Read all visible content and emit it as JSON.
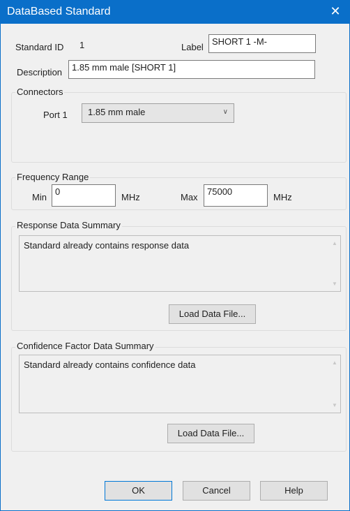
{
  "window": {
    "title": "DataBased Standard",
    "close_glyph": "✕"
  },
  "standard": {
    "id_label": "Standard ID",
    "id_value": "1",
    "label_label": "Label",
    "label_value": "SHORT 1 -M-",
    "description_label": "Description",
    "description_value": "1.85 mm male [SHORT 1]"
  },
  "connectors": {
    "group_label": "Connectors",
    "port1_label": "Port 1",
    "port1_value": "1.85 mm male"
  },
  "frequency_range": {
    "group_label": "Frequency Range",
    "min_label": "Min",
    "min_value": "0",
    "min_unit": "MHz",
    "max_label": "Max",
    "max_value": "75000",
    "max_unit": "MHz"
  },
  "response_data": {
    "group_label": "Response Data Summary",
    "text": "Standard already contains response data",
    "load_button": "Load Data File..."
  },
  "confidence_data": {
    "group_label": "Confidence Factor Data Summary",
    "text": "Standard already contains confidence data",
    "load_button": "Load Data File..."
  },
  "footer": {
    "ok": "OK",
    "cancel": "Cancel",
    "help": "Help"
  },
  "colors": {
    "titlebar": "#0a6fc9",
    "default_button_border": "#0078d7"
  },
  "icons": [
    "close-icon",
    "chevron-down-icon",
    "scroll-up-icon",
    "scroll-down-icon"
  ]
}
